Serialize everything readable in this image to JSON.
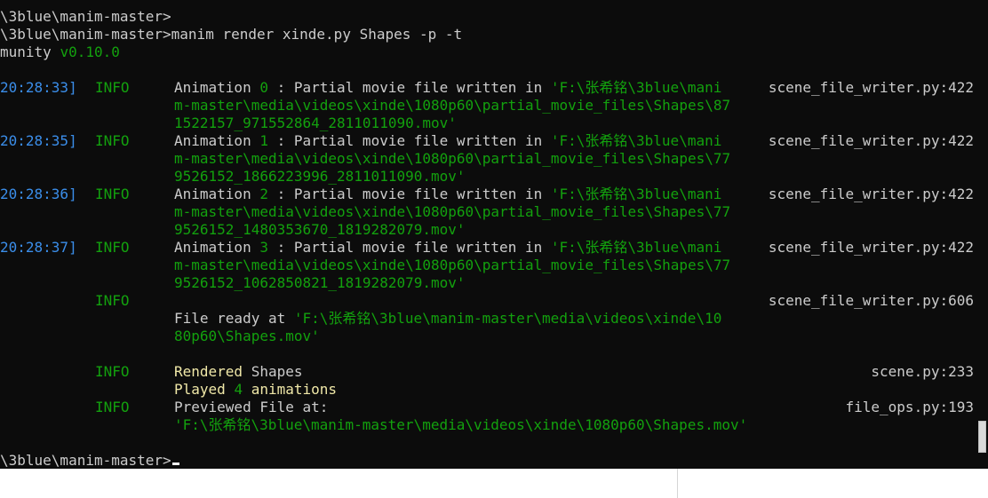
{
  "prompt_lines": [
    "\\3blue\\manim-master>",
    "\\3blue\\manim-master>manim render xinde.py Shapes -p -t"
  ],
  "version_line": {
    "prefix": "munity ",
    "version": "v0.10.0"
  },
  "logs": [
    {
      "time": "20:28:33]",
      "level": "INFO",
      "pre": "Animation ",
      "num": "0",
      "mid": " : Partial movie file written in ",
      "path1": "'F:\\张希铭\\3blue\\mani",
      "path2": "m-master\\media\\videos\\xinde\\1080p60\\partial_movie_files\\Shapes\\87",
      "path3": "1522157_971552864_2811011090.mov'",
      "src": "scene_file_writer.py:422"
    },
    {
      "time": "20:28:35]",
      "level": "INFO",
      "pre": "Animation ",
      "num": "1",
      "mid": " : Partial movie file written in ",
      "path1": "'F:\\张希铭\\3blue\\mani",
      "path2": "m-master\\media\\videos\\xinde\\1080p60\\partial_movie_files\\Shapes\\77",
      "path3": "9526152_1866223996_2811011090.mov'",
      "src": "scene_file_writer.py:422"
    },
    {
      "time": "20:28:36]",
      "level": "INFO",
      "pre": "Animation ",
      "num": "2",
      "mid": " : Partial movie file written in ",
      "path1": "'F:\\张希铭\\3blue\\mani",
      "path2": "m-master\\media\\videos\\xinde\\1080p60\\partial_movie_files\\Shapes\\77",
      "path3": "9526152_1480353670_1819282079.mov'",
      "src": "scene_file_writer.py:422"
    },
    {
      "time": "20:28:37]",
      "level": "INFO",
      "pre": "Animation ",
      "num": "3",
      "mid": " : Partial movie file written in ",
      "path1": "'F:\\张希铭\\3blue\\mani",
      "path2": "m-master\\media\\videos\\xinde\\1080p60\\partial_movie_files\\Shapes\\77",
      "path3": "9526152_1062850821_1819282079.mov'",
      "src": "scene_file_writer.py:422"
    }
  ],
  "file_ready": {
    "level": "INFO",
    "src": "scene_file_writer.py:606",
    "label": "File ready at ",
    "path1": "'F:\\张希铭\\3blue\\manim-master\\media\\videos\\xinde\\10",
    "path2": "80p60\\Shapes.mov'"
  },
  "rendered": {
    "level": "INFO",
    "src": "scene.py:233",
    "label": "Rendered ",
    "scene": "Shapes",
    "played_pre": "Played ",
    "played_num": "4",
    "played_post": " animations"
  },
  "previewed": {
    "level": "INFO",
    "src": "file_ops.py:193",
    "label": "Previewed File at:",
    "path": "'F:\\张希铭\\3blue\\manim-master\\media\\videos\\xinde\\1080p60\\Shapes.mov'"
  },
  "final_prompt": "\\3blue\\manim-master>",
  "colors": {
    "background": "#0c0c0c",
    "text": "#cccccc",
    "timestamp": "#3b8eea",
    "info": "#13a10e",
    "highlight": "#f0e8a8"
  }
}
